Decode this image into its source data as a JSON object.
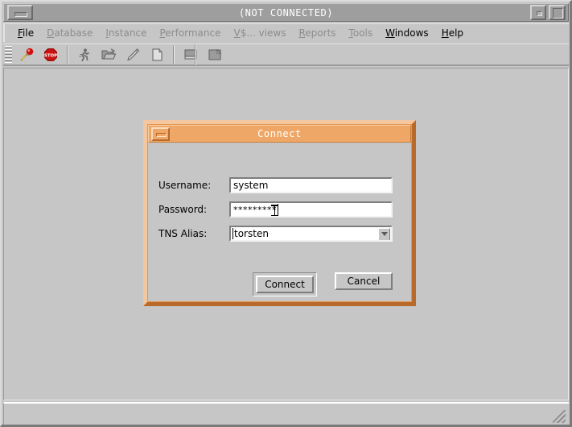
{
  "window": {
    "title": "(NOT CONNECTED)",
    "minimize_icon": "minimize-icon",
    "restore_icon": "restore-icon",
    "maximize_icon": "maximize-icon"
  },
  "menu": {
    "items": [
      {
        "label": "File",
        "mnemonic": "F",
        "enabled": true
      },
      {
        "label": "Database",
        "mnemonic": "D",
        "enabled": false
      },
      {
        "label": "Instance",
        "mnemonic": "I",
        "enabled": false
      },
      {
        "label": "Performance",
        "mnemonic": "P",
        "enabled": false
      },
      {
        "label": "V$... views",
        "mnemonic": "V",
        "enabled": false
      },
      {
        "label": "Reports",
        "mnemonic": "R",
        "enabled": false
      },
      {
        "label": "Tools",
        "mnemonic": "T",
        "enabled": false
      },
      {
        "label": "Windows",
        "mnemonic": "W",
        "enabled": true
      },
      {
        "label": "Help",
        "mnemonic": "H",
        "enabled": true
      }
    ]
  },
  "toolbar": {
    "buttons": [
      {
        "icon": "connect-plug-icon",
        "enabled": true
      },
      {
        "icon": "stop-sign-icon",
        "enabled": true
      },
      {
        "icon": "running-person-icon",
        "enabled": false
      },
      {
        "icon": "open-folder-icon",
        "enabled": false
      },
      {
        "icon": "pencil-edit-icon",
        "enabled": false
      },
      {
        "icon": "new-document-icon",
        "enabled": false
      },
      {
        "icon": "save-disk-icon",
        "enabled": false
      },
      {
        "icon": "folder-page-icon",
        "enabled": false
      }
    ]
  },
  "dialog": {
    "title": "Connect",
    "minimize_icon": "minimize-icon",
    "fields": [
      {
        "label": "Username:",
        "value": "system",
        "type": "text"
      },
      {
        "label": "Password:",
        "value": "*********",
        "type": "password"
      },
      {
        "label": "TNS Alias:",
        "value": "torsten",
        "type": "combo"
      }
    ],
    "buttons": [
      {
        "label": "Connect",
        "default": true
      },
      {
        "label": "Cancel",
        "default": false
      }
    ]
  },
  "colors": {
    "dialog_titlebar": "#efa767",
    "dialog_frame_light": "#f3c79f",
    "dialog_frame_dark": "#b86a2a",
    "window_face": "#c6c6c6",
    "window_titlebar": "#9e9e9e",
    "stop_red": "#cc1111"
  },
  "status_bar": {
    "text": "",
    "resize_grip_icon": "resize-grip-icon"
  }
}
